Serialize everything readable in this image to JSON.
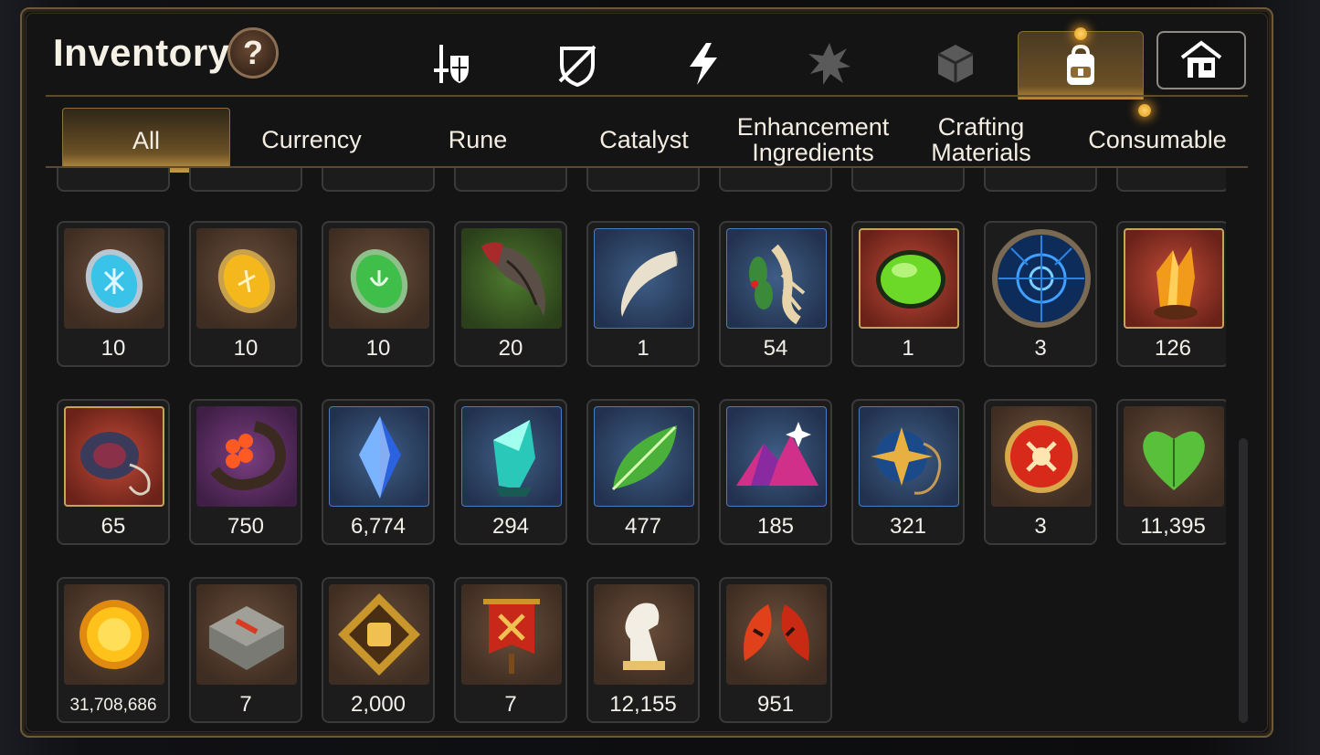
{
  "title": "Inventory",
  "help_label": "?",
  "category_tabs": [
    {
      "icon": "sword-shield-icon"
    },
    {
      "icon": "broken-shield-icon"
    },
    {
      "icon": "lightning-icon"
    },
    {
      "icon": "splat-icon"
    },
    {
      "icon": "cube-icon"
    },
    {
      "icon": "backpack-icon",
      "active": true
    },
    {
      "icon": "house-icon"
    }
  ],
  "sub_tabs": [
    {
      "label": "All",
      "active": true
    },
    {
      "label": "Currency"
    },
    {
      "label": "Rune"
    },
    {
      "label": "Catalyst"
    },
    {
      "label": "Enhancement Ingredients"
    },
    {
      "label": "Crafting Materials"
    },
    {
      "label": "Consumable"
    }
  ],
  "items": [
    {
      "icon": "blue-rune-icon",
      "qty": "10"
    },
    {
      "icon": "yellow-rune-icon",
      "qty": "10"
    },
    {
      "icon": "green-rune-icon",
      "qty": "10"
    },
    {
      "icon": "claw-icon",
      "qty": "20"
    },
    {
      "icon": "fang-icon",
      "qty": "1"
    },
    {
      "icon": "ginseng-icon",
      "qty": "54"
    },
    {
      "icon": "green-orb-icon",
      "qty": "1"
    },
    {
      "icon": "blue-seal-icon",
      "qty": "3"
    },
    {
      "icon": "orange-crystal-icon",
      "qty": "126"
    },
    {
      "icon": "ring-ornament-icon",
      "qty": "65"
    },
    {
      "icon": "flower-ring-icon",
      "qty": "750"
    },
    {
      "icon": "blue-gem-icon",
      "qty": "6,774"
    },
    {
      "icon": "teal-crystal-icon",
      "qty": "294"
    },
    {
      "icon": "leaf-icon",
      "qty": "477"
    },
    {
      "icon": "pink-mountain-icon",
      "qty": "185"
    },
    {
      "icon": "star-pendant-icon",
      "qty": "321"
    },
    {
      "icon": "red-badge-icon",
      "qty": "3"
    },
    {
      "icon": "green-heart-icon",
      "qty": "11,395"
    },
    {
      "icon": "gold-coin-icon",
      "qty": "31,708,686"
    },
    {
      "icon": "stone-compass-icon",
      "qty": "7"
    },
    {
      "icon": "fist-emblem-icon",
      "qty": "2,000"
    },
    {
      "icon": "banner-icon",
      "qty": "7"
    },
    {
      "icon": "knight-chess-icon",
      "qty": "12,155"
    },
    {
      "icon": "red-leaves-icon",
      "qty": "951"
    }
  ],
  "colors": {
    "accent": "#c89b46",
    "frame": "#6e5a36",
    "notification": "#f0a020"
  }
}
